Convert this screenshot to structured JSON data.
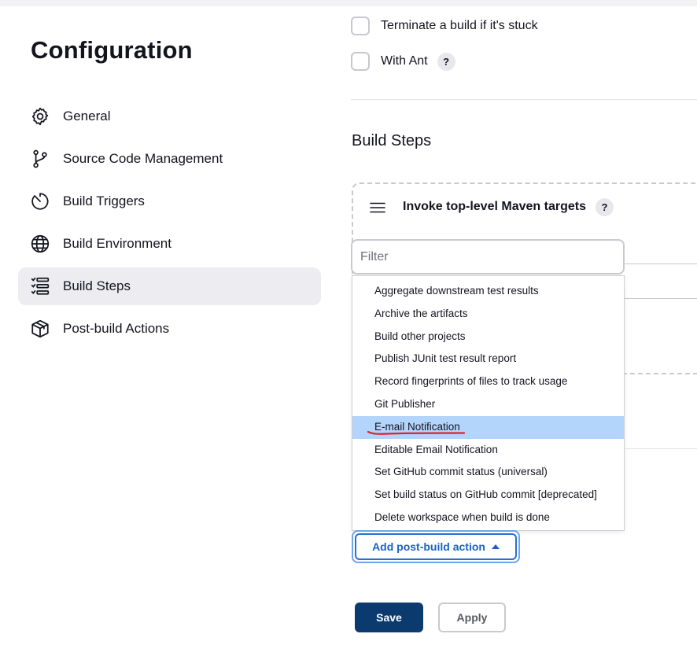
{
  "sidebar": {
    "title": "Configuration",
    "items": [
      {
        "label": "General",
        "icon": "gear-icon",
        "active": false
      },
      {
        "label": "Source Code Management",
        "icon": "git-branch-icon",
        "active": false
      },
      {
        "label": "Build Triggers",
        "icon": "clock-icon",
        "active": false
      },
      {
        "label": "Build Environment",
        "icon": "globe-icon",
        "active": false
      },
      {
        "label": "Build Steps",
        "icon": "list-steps-icon",
        "active": true
      },
      {
        "label": "Post-build Actions",
        "icon": "package-icon",
        "active": false
      }
    ]
  },
  "options": {
    "terminate_label": "Terminate a build if it's stuck",
    "with_ant_label": "With Ant",
    "help_glyph": "?"
  },
  "build_steps": {
    "section_title": "Build Steps",
    "step_title": "Invoke top-level Maven targets"
  },
  "filter": {
    "placeholder": "Filter",
    "value": ""
  },
  "dropdown": {
    "highlighted_item": "E-mail Notification",
    "items": [
      "Aggregate downstream test results",
      "Archive the artifacts",
      "Build other projects",
      "Publish JUnit test result report",
      "Record fingerprints of files to track usage",
      "Git Publisher",
      "E-mail Notification",
      "Editable Email Notification",
      "Set GitHub commit status (universal)",
      "Set build status on GitHub commit [deprecated]",
      "Delete workspace when build is done"
    ]
  },
  "actions": {
    "add_post_build_label": "Add post-build action",
    "save_label": "Save",
    "apply_label": "Apply"
  },
  "colors": {
    "primary": "#0b3b6e",
    "link_blue": "#1a62c6",
    "highlight": "#b3d4fb",
    "annotation_red": "#d9232f",
    "active_nav_bg": "#ececf1"
  }
}
